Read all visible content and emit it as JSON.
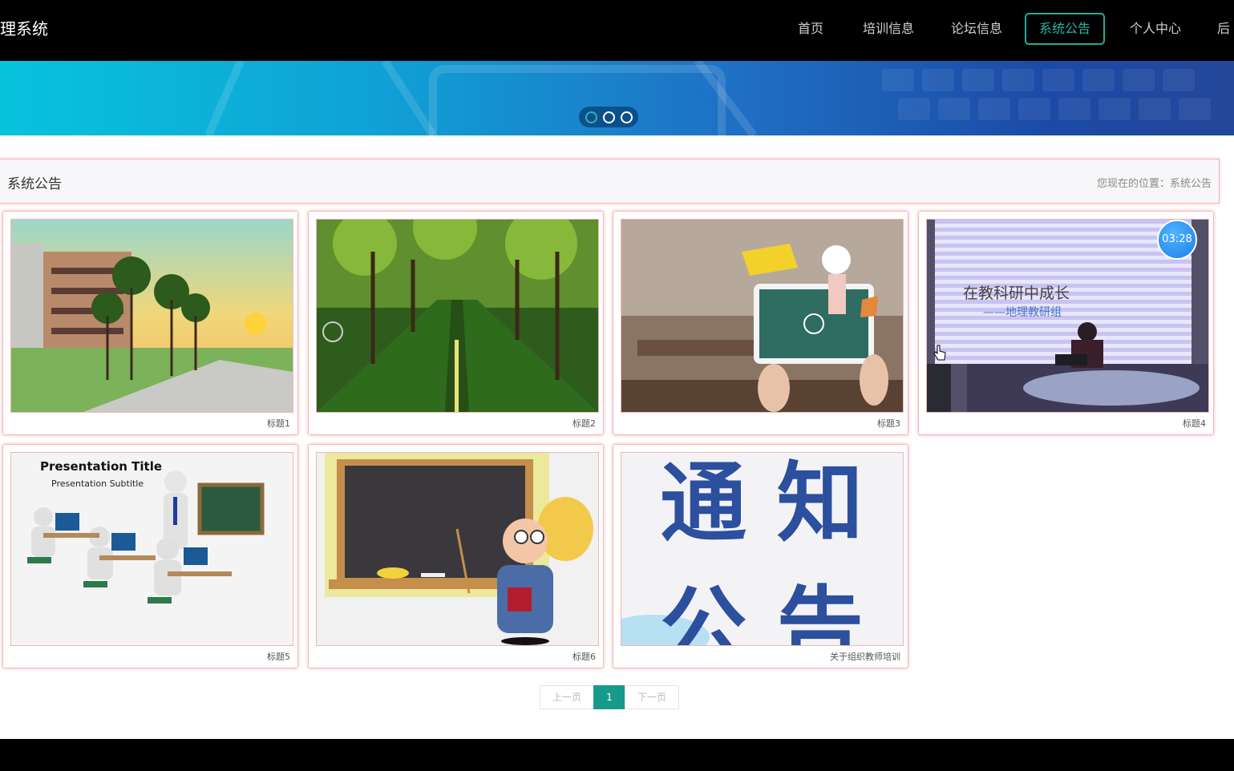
{
  "nav": {
    "brand": "理系统",
    "items": [
      {
        "label": "首页"
      },
      {
        "label": "培训信息"
      },
      {
        "label": "论坛信息"
      },
      {
        "label": "系统公告"
      },
      {
        "label": "个人中心"
      },
      {
        "label": "后"
      }
    ],
    "active_index": 3
  },
  "banner": {
    "slide_count": 3,
    "active_slide": 0
  },
  "section": {
    "title": "系统公告",
    "breadcrumb": "您现在的位置：系统公告"
  },
  "cards": [
    {
      "caption": "标题1"
    },
    {
      "caption": "标题2"
    },
    {
      "caption": "标题3"
    },
    {
      "caption": "标题4",
      "image_text": {
        "line1": "在教科研中成长",
        "line2": "——地理教研组"
      }
    },
    {
      "caption": "标题5",
      "image_text": {
        "line1": "Presentation Title",
        "line2": "Presentation Subtitle"
      }
    },
    {
      "caption": "标题6"
    },
    {
      "caption": "关于组织教师培训",
      "image_text": {
        "line1": "通 知",
        "line2": "公 告"
      }
    }
  ],
  "pagination": {
    "prev": "上一页",
    "current": "1",
    "next": "下一页"
  },
  "overlay": {
    "timer": "03:28"
  },
  "colors": {
    "accent": "#179a8c",
    "card_border": "#f5b7bc"
  }
}
